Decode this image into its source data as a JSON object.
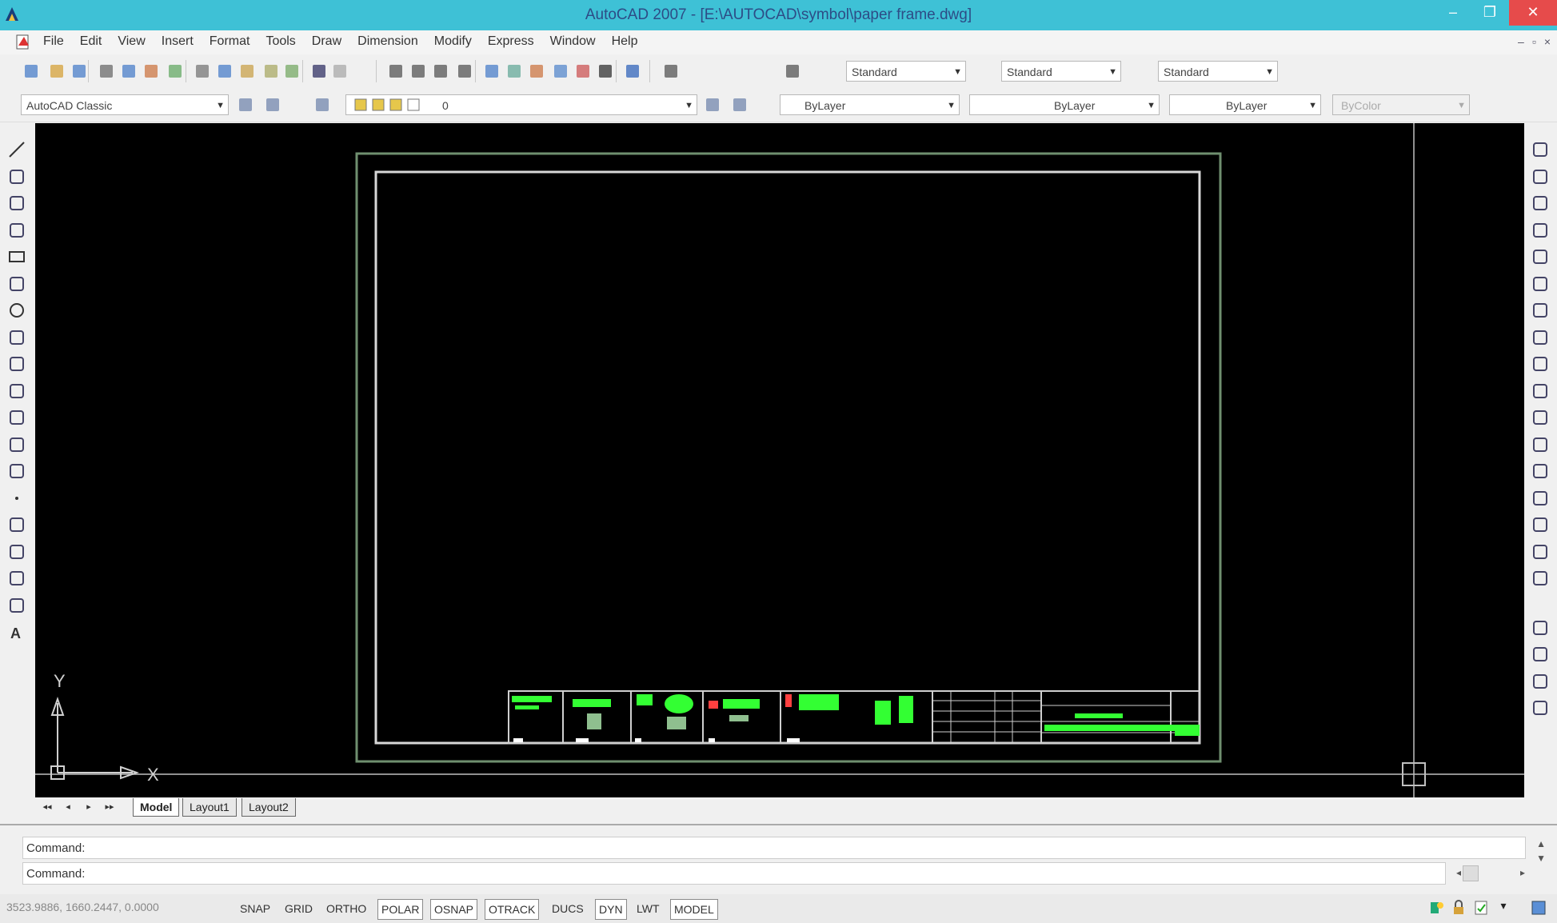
{
  "window": {
    "title": "AutoCAD 2007 - [E:\\AUTOCAD\\symbol\\paper frame.dwg]",
    "minimize": "–",
    "maximize": "❐",
    "close": "✕"
  },
  "menu": {
    "items": [
      "File",
      "Edit",
      "View",
      "Insert",
      "Format",
      "Tools",
      "Draw",
      "Dimension",
      "Modify",
      "Express",
      "Window",
      "Help"
    ],
    "mdi_controls": [
      "–",
      "▫",
      "×"
    ]
  },
  "toolbar_styles": {
    "text_style": "Standard",
    "dim_style": "Standard",
    "table_style": "Standard"
  },
  "toolbar_layers": {
    "workspace": "AutoCAD Classic",
    "layer": "0",
    "color": "ByLayer",
    "linetype": "ByLayer",
    "lineweight": "ByLayer",
    "plotstyle": "ByColor"
  },
  "tabs": {
    "nav": [
      "◂◂",
      "◂",
      "▸",
      "▸▸"
    ],
    "items": [
      "Model",
      "Layout1",
      "Layout2"
    ],
    "active": "Model"
  },
  "ucs": {
    "x_label": "X",
    "y_label": "Y"
  },
  "command": {
    "history": "Command:",
    "prompt": "Command:"
  },
  "status": {
    "coords": "3523.9886, 1660.2447, 0.0000",
    "toggles": [
      {
        "label": "SNAP",
        "on": false
      },
      {
        "label": "GRID",
        "on": false
      },
      {
        "label": "ORTHO",
        "on": false
      },
      {
        "label": "POLAR",
        "on": true
      },
      {
        "label": "OSNAP",
        "on": true
      },
      {
        "label": "OTRACK",
        "on": true
      },
      {
        "label": "DUCS",
        "on": false
      },
      {
        "label": "DYN",
        "on": true
      },
      {
        "label": "LWT",
        "on": false
      },
      {
        "label": "MODEL",
        "on": true
      }
    ]
  },
  "colors": {
    "titlebar": "#3ec1d6",
    "drawing_bg": "#000000",
    "frame_outer": "#6f8f6f",
    "frame_inner": "#d8d8d8",
    "titleblock_green": "#33ff33"
  },
  "icons": {
    "left_toolbar": [
      "line-icon",
      "construction-line-icon",
      "polyline-icon",
      "polygon-icon",
      "rectangle-icon",
      "arc-icon",
      "circle-icon",
      "revision-cloud-icon",
      "spline-icon",
      "ellipse-icon",
      "ellipse-arc-icon",
      "insert-block-icon",
      "make-block-icon",
      "point-icon",
      "hatch-icon",
      "gradient-icon",
      "region-icon",
      "table-icon",
      "multiline-text-icon"
    ],
    "right_toolbar": [
      "erase-icon",
      "copy-icon",
      "mirror-icon",
      "offset-icon",
      "array-icon",
      "move-icon",
      "rotate-icon",
      "scale-icon",
      "stretch-icon",
      "trim-icon",
      "extend-icon",
      "break-at-point-icon",
      "break-icon",
      "join-icon",
      "chamfer-icon",
      "fillet-icon",
      "explode-icon",
      "draworder-icon",
      "properties-icon",
      "layer-icon",
      "block-editor-icon"
    ]
  }
}
